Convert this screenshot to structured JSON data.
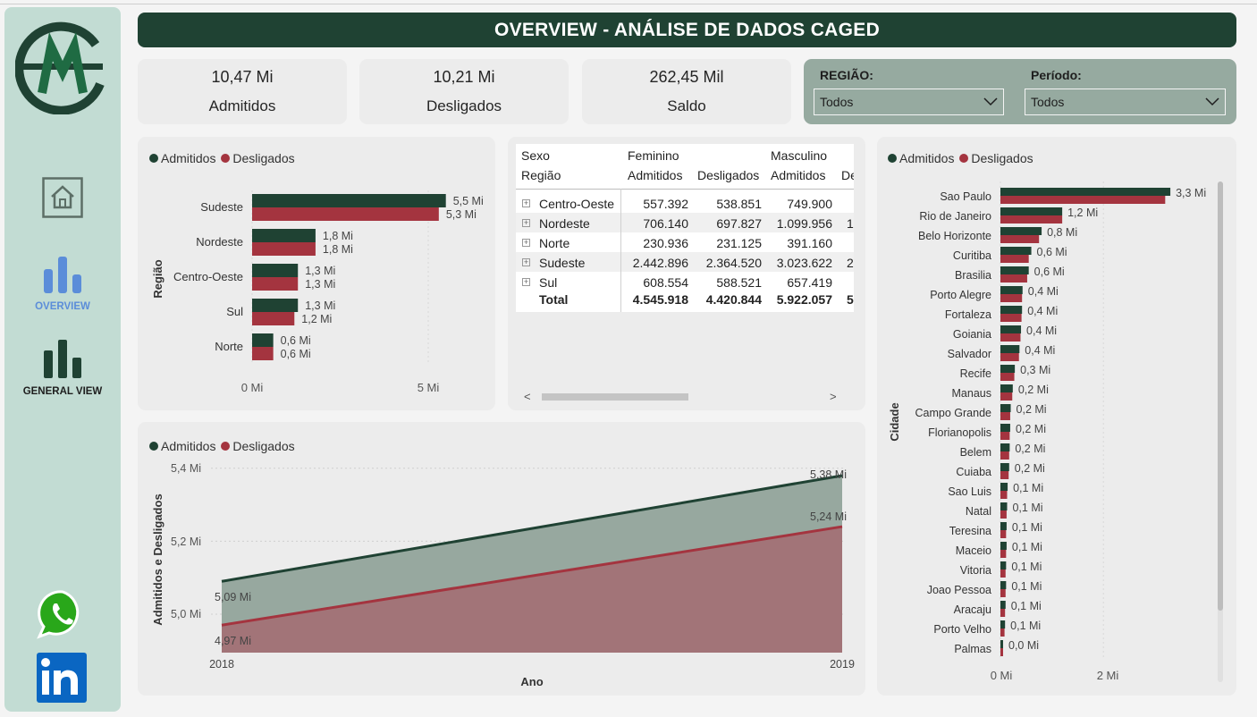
{
  "header": {
    "title": "OVERVIEW - ANÁLISE DE DADOS CAGED"
  },
  "sidebar": {
    "logo": "sm-logo",
    "items": [
      {
        "label": "",
        "icon": "home-icon"
      },
      {
        "label": "OVERVIEW",
        "icon": "bar-chart-icon",
        "active": true
      },
      {
        "label": "GENERAL VIEW",
        "icon": "bar-chart-icon"
      }
    ],
    "social": [
      {
        "icon": "whatsapp-icon"
      },
      {
        "icon": "linkedin-icon"
      }
    ]
  },
  "kpis": [
    {
      "value": "10,47 Mi",
      "label": "Admitidos"
    },
    {
      "value": "10,21 Mi",
      "label": "Desligados"
    },
    {
      "value": "262,45 Mil",
      "label": "Saldo"
    }
  ],
  "filters": {
    "regiao": {
      "label": "REGIÃO:",
      "value": "Todos"
    },
    "periodo": {
      "label": "Período:",
      "value": "Todos"
    }
  },
  "colors": {
    "admitidos": "#1f4233",
    "desligados": "#a4343f",
    "sidebar": "#c2dcd3",
    "active": "#5b8dd9"
  },
  "legend": {
    "admitidos": "Admitidos",
    "desligados": "Desligados"
  },
  "region_chart": {
    "ylabel": "Região",
    "x_ticks": [
      "0 Mi",
      "5 Mi"
    ]
  },
  "matrix": {
    "header_sexo": "Sexo",
    "header_regiao": "Região",
    "groups": [
      "Feminino",
      "Masculino"
    ],
    "cols": [
      "Admitidos",
      "Desligados",
      "Admitidos",
      "De"
    ],
    "rows": [
      {
        "regiao": "Centro-Oeste",
        "cells": [
          "557.392",
          "538.851",
          "749.900",
          ""
        ]
      },
      {
        "regiao": "Nordeste",
        "cells": [
          "706.140",
          "697.827",
          "1.099.956",
          "1"
        ]
      },
      {
        "regiao": "Norte",
        "cells": [
          "230.936",
          "231.125",
          "391.160",
          ""
        ]
      },
      {
        "regiao": "Sudeste",
        "cells": [
          "2.442.896",
          "2.364.520",
          "3.023.622",
          "2"
        ]
      },
      {
        "regiao": "Sul",
        "cells": [
          "608.554",
          "588.521",
          "657.419",
          ""
        ]
      }
    ],
    "total": {
      "label": "Total",
      "cells": [
        "4.545.918",
        "4.420.844",
        "5.922.057",
        "5."
      ]
    },
    "scroll_left": "<",
    "scroll_right": ">"
  },
  "area_chart": {
    "ylabel": "Admitidos e Desligados",
    "xlabel": "Ano",
    "y_ticks": [
      "5,4 Mi",
      "5,2 Mi",
      "5,0 Mi"
    ]
  },
  "city_chart": {
    "ylabel": "Cidade",
    "x_ticks": [
      "0 Mi",
      "2 Mi"
    ]
  },
  "chart_data": [
    {
      "type": "bar",
      "orientation": "horizontal",
      "categories": [
        "Sudeste",
        "Nordeste",
        "Centro-Oeste",
        "Sul",
        "Norte"
      ],
      "series": [
        {
          "name": "Admitidos",
          "values": [
            5.5,
            1.8,
            1.3,
            1.3,
            0.6
          ],
          "labels": [
            "5,5 Mi",
            "1,8 Mi",
            "1,3 Mi",
            "1,3 Mi",
            "0,6 Mi"
          ]
        },
        {
          "name": "Desligados",
          "values": [
            5.3,
            1.8,
            1.3,
            1.2,
            0.6
          ],
          "labels": [
            "5,3 Mi",
            "1,8 Mi",
            "1,3 Mi",
            "1,2 Mi",
            "0,6 Mi"
          ]
        }
      ],
      "xlabel": "",
      "ylabel": "Região",
      "xlim": [
        0,
        5.5
      ],
      "legend": "top-left"
    },
    {
      "type": "area",
      "x": [
        "2018",
        "2019"
      ],
      "series": [
        {
          "name": "Admitidos",
          "values": [
            5.09,
            5.38
          ],
          "labels": [
            "5,09 Mi",
            "5,38 Mi"
          ]
        },
        {
          "name": "Desligados",
          "values": [
            4.97,
            5.24
          ],
          "labels": [
            "4,97 Mi",
            "5,24 Mi"
          ]
        }
      ],
      "xlabel": "Ano",
      "ylabel": "Admitidos e Desligados",
      "ylim": [
        4.95,
        5.4
      ],
      "legend": "top-left",
      "grid": true
    },
    {
      "type": "bar",
      "orientation": "horizontal",
      "categories": [
        "Sao Paulo",
        "Rio de Janeiro",
        "Belo Horizonte",
        "Curitiba",
        "Brasilia",
        "Porto Alegre",
        "Fortaleza",
        "Goiania",
        "Salvador",
        "Recife",
        "Manaus",
        "Campo Grande",
        "Florianopolis",
        "Belem",
        "Cuiaba",
        "Sao Luis",
        "Natal",
        "Teresina",
        "Maceio",
        "Vitoria",
        "Joao Pessoa",
        "Aracaju",
        "Porto Velho",
        "Palmas"
      ],
      "series": [
        {
          "name": "Admitidos",
          "values": [
            3.3,
            1.2,
            0.8,
            0.6,
            0.55,
            0.43,
            0.42,
            0.4,
            0.37,
            0.28,
            0.24,
            0.2,
            0.19,
            0.18,
            0.17,
            0.14,
            0.13,
            0.12,
            0.12,
            0.11,
            0.11,
            0.1,
            0.09,
            0.05
          ]
        },
        {
          "name": "Desligados",
          "values": [
            3.2,
            1.2,
            0.75,
            0.55,
            0.52,
            0.42,
            0.41,
            0.39,
            0.36,
            0.27,
            0.23,
            0.19,
            0.18,
            0.17,
            0.16,
            0.13,
            0.12,
            0.11,
            0.11,
            0.1,
            0.1,
            0.09,
            0.08,
            0.05
          ]
        }
      ],
      "labels": [
        "3,3 Mi",
        "1,2 Mi",
        "0,8 Mi",
        "0,6 Mi",
        "0,6 Mi",
        "0,4 Mi",
        "0,4 Mi",
        "0,4 Mi",
        "0,4 Mi",
        "0,3 Mi",
        "0,2 Mi",
        "0,2 Mi",
        "0,2 Mi",
        "0,2 Mi",
        "0,2 Mi",
        "0,1 Mi",
        "0,1 Mi",
        "0,1 Mi",
        "0,1 Mi",
        "0,1 Mi",
        "0,1 Mi",
        "0,1 Mi",
        "0,1 Mi",
        "0,0 Mi"
      ],
      "xlabel": "",
      "ylabel": "Cidade",
      "xlim": [
        0,
        3.4
      ],
      "legend": "top-left"
    }
  ]
}
